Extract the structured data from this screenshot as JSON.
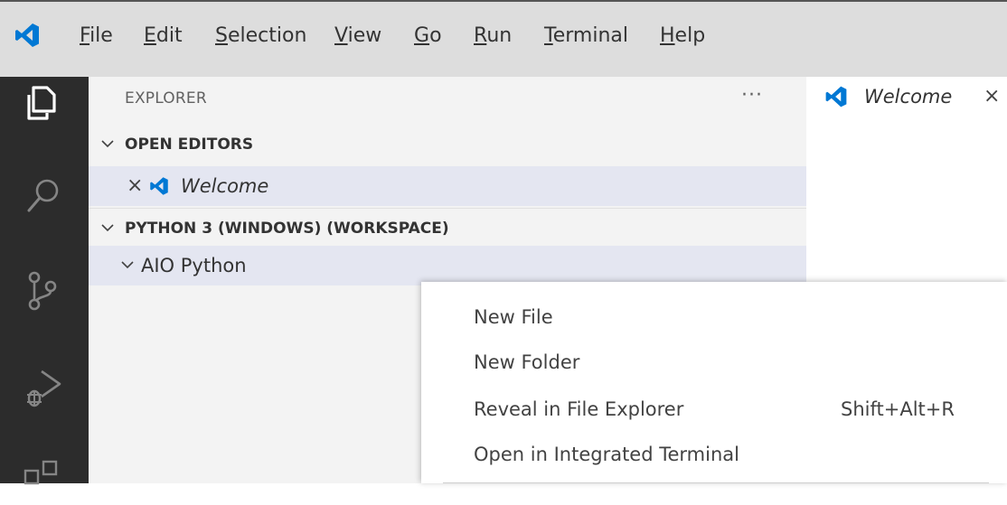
{
  "menubar": {
    "items": [
      {
        "label": "File",
        "mnemonic": "F",
        "rest": "ile"
      },
      {
        "label": "Edit",
        "mnemonic": "E",
        "rest": "dit"
      },
      {
        "label": "Selection",
        "mnemonic": "S",
        "rest": "election"
      },
      {
        "label": "View",
        "mnemonic": "V",
        "rest": "iew"
      },
      {
        "label": "Go",
        "mnemonic": "G",
        "rest": "o"
      },
      {
        "label": "Run",
        "mnemonic": "R",
        "rest": "un"
      },
      {
        "label": "Terminal",
        "mnemonic": "T",
        "rest": "erminal"
      },
      {
        "label": "Help",
        "mnemonic": "H",
        "rest": "elp"
      }
    ]
  },
  "activitybar": {
    "icons": [
      "files-icon",
      "search-icon",
      "source-control-icon",
      "run-debug-icon",
      "extensions-icon"
    ]
  },
  "sidebar": {
    "title": "EXPLORER",
    "more": "···",
    "open_editors": {
      "header": "OPEN EDITORS",
      "items": [
        {
          "close": "×",
          "label": "Welcome"
        }
      ]
    },
    "workspace": {
      "header": "PYTHON 3 (WINDOWS) (WORKSPACE)",
      "folder": "AIO Python"
    }
  },
  "editor": {
    "tab": {
      "label": "Welcome",
      "close": "×"
    }
  },
  "context_menu": {
    "items": [
      {
        "label": "New File",
        "shortcut": ""
      },
      {
        "label": "New Folder",
        "shortcut": ""
      },
      {
        "label": "Reveal in File Explorer",
        "shortcut": "Shift+Alt+R"
      },
      {
        "label": "Open in Integrated Terminal",
        "shortcut": ""
      }
    ]
  },
  "colors": {
    "vscode_blue": "#0078d4",
    "activitybar_bg": "#2c2c2c",
    "sidebar_bg": "#f3f3f3",
    "selected_row": "#e4e6f1"
  }
}
